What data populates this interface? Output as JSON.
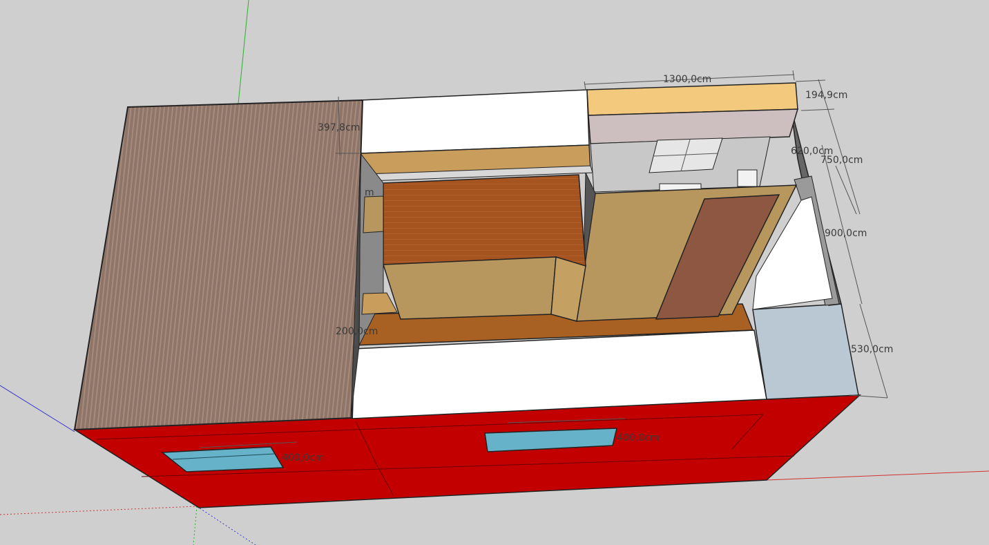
{
  "viewport": {
    "background": "#cfcfcf",
    "colors": {
      "roof": "#8f7468",
      "roof_stripe": "#a28579",
      "wall_red": "#c20000",
      "wall_top_white": "#ffffff",
      "wood_light": "#b8975f",
      "wood_dark": "#a5531f",
      "floor": "#a86123",
      "door_brown": "#8d5741",
      "window_blue": "#66b2c9",
      "annex_blue": "#b9c8d2",
      "top_yellow": "#f3c97e",
      "mauve": "#cdbfc0",
      "grey_wall": "#666666",
      "axis_green": "#2ab02a",
      "axis_red": "#d03030",
      "axis_blue": "#3030d0"
    },
    "dimensions": [
      "1300,0cm",
      "194,9cm",
      "397,8cm",
      "620,0cm",
      "750,0cm",
      "900,0cm",
      "200,0cm",
      "530,0cm",
      "400,0cm",
      "400,0cm",
      "m"
    ]
  }
}
